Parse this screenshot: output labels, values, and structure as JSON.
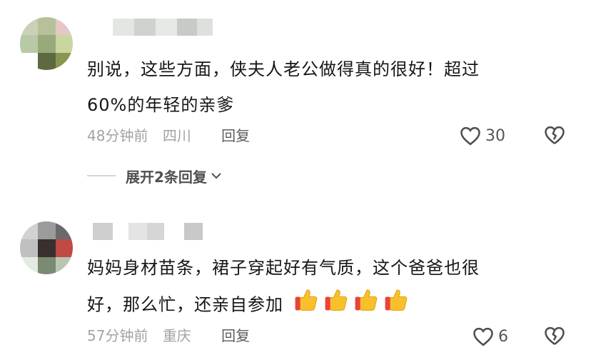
{
  "comments": [
    {
      "text_line1": "别说，这些方面，侠夫人老公做得真的很好！超过",
      "text_line2": "60%的年轻的亲爹",
      "time": "48分钟前",
      "location": "四川",
      "reply_label": "回复",
      "likes": "30",
      "expand_label": "展开2条回复",
      "avatar_colors": [
        "#c9d1b7",
        "#b7c199",
        "#e4c7c7",
        "#b8c9a5",
        "#9aa97a",
        "#c9d79f",
        "#ffffff",
        "#5d6a3f",
        "#88964f"
      ]
    },
    {
      "text_line1": "妈妈身材苗条，裙子穿起好有气质，这个爸爸也很",
      "text_line2": "好，那么忙，还亲自参加",
      "emojis": [
        "thumbs-up-icon",
        "thumbs-up-icon",
        "thumbs-up-icon",
        "thumbs-up-icon"
      ],
      "time": "57分钟前",
      "location": "重庆",
      "reply_label": "回复",
      "likes": "6",
      "avatar_colors": [
        "#d2d2d2",
        "#9b9b9b",
        "#6a6a6a",
        "#c0c0c0",
        "#3a2f2f",
        "#c04a44",
        "#e4ebe2",
        "#7a8a73",
        "#b8c7b4"
      ]
    }
  ],
  "colors": {
    "text": "#161616",
    "meta": "#a3a3a3",
    "icon": "#4d4d4d"
  }
}
